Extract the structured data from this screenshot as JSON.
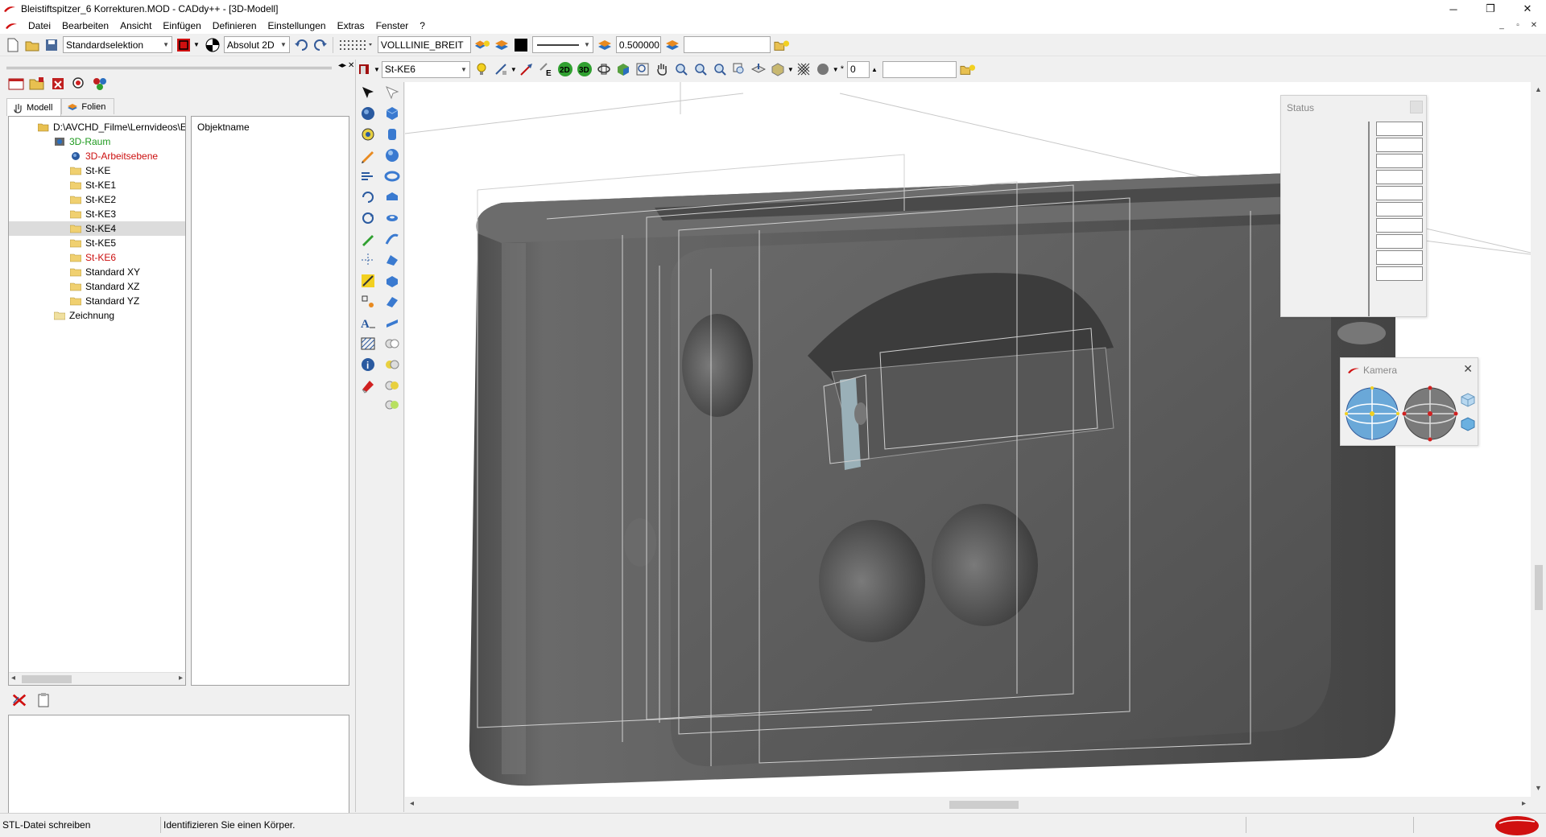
{
  "window": {
    "title": "Bleistiftspitzer_6 Korrekturen.MOD  -  CADdy++ - [3D-Modell]",
    "minimize_label": "─",
    "maximize_label": "❐",
    "close_label": "✕"
  },
  "menu": {
    "items": [
      "Datei",
      "Bearbeiten",
      "Ansicht",
      "Einfügen",
      "Definieren",
      "Einstellungen",
      "Extras",
      "Fenster",
      "?"
    ]
  },
  "toolbar1": {
    "selection_mode": "Standardselektion",
    "coordinate_mode": "Absolut 2D",
    "line_type": "VOLLLINIE_BREIT",
    "line_width": "0.500000",
    "extra_field": ""
  },
  "toolbar2": {
    "layer": "St-KE6",
    "mode_2d": "2D",
    "mode_3d": "3D",
    "counter": "0",
    "extra_field": ""
  },
  "left_panel": {
    "tabs": [
      "Modell",
      "Folien"
    ],
    "tree": [
      {
        "label": "D:\\AVCHD_Filme\\Lernvideos\\E",
        "level": 0,
        "icon": "folder-open-icon",
        "color": "default"
      },
      {
        "label": "3D-Raum",
        "level": 1,
        "icon": "space-icon",
        "color": "green"
      },
      {
        "label": "3D-Arbeitsebene",
        "level": 2,
        "icon": "workplane-icon",
        "color": "red"
      },
      {
        "label": "St-KE",
        "level": 2,
        "icon": "folder-icon",
        "color": "default"
      },
      {
        "label": "St-KE1",
        "level": 2,
        "icon": "folder-icon",
        "color": "default"
      },
      {
        "label": "St-KE2",
        "level": 2,
        "icon": "folder-icon",
        "color": "default"
      },
      {
        "label": "St-KE3",
        "level": 2,
        "icon": "folder-icon",
        "color": "default"
      },
      {
        "label": "St-KE4",
        "level": 2,
        "icon": "folder-icon",
        "color": "default",
        "selected": true
      },
      {
        "label": "St-KE5",
        "level": 2,
        "icon": "folder-icon",
        "color": "default"
      },
      {
        "label": "St-KE6",
        "level": 2,
        "icon": "folder-icon",
        "color": "red"
      },
      {
        "label": "Standard XY",
        "level": 2,
        "icon": "folder-icon",
        "color": "default"
      },
      {
        "label": "Standard XZ",
        "level": 2,
        "icon": "folder-icon",
        "color": "default"
      },
      {
        "label": "Standard YZ",
        "level": 2,
        "icon": "folder-icon",
        "color": "default"
      },
      {
        "label": "Zeichnung",
        "level": 1,
        "icon": "folder-open-icon",
        "color": "default"
      }
    ],
    "object_header": "Objektname"
  },
  "panels": {
    "status_title": "Status",
    "camera_title": "Kamera",
    "camera_close": "✕"
  },
  "statusbar": {
    "left": "STL-Datei schreiben",
    "message": "Identifizieren Sie einen Körper.",
    "extra1": "",
    "extra2": ""
  },
  "colors": {
    "accent_red": "#cc1010",
    "tree_green": "#1e9a1e",
    "model_gray": "#5a5a5a"
  }
}
